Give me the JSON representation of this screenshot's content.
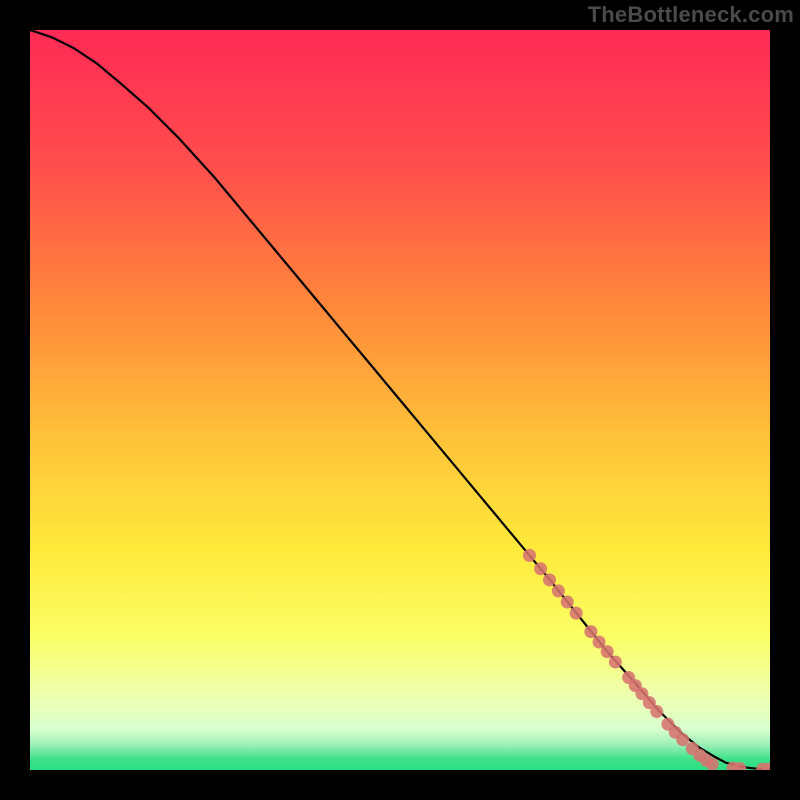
{
  "watermark": "TheBottleneck.com",
  "colors": {
    "curve": "#000000",
    "dot_fill": "#d6736e",
    "dot_stroke": "#8f3c38",
    "plot_bg_top": "#ff2a55",
    "plot_bg_mid1": "#ff8a3a",
    "plot_bg_mid2": "#ffd23a",
    "plot_bg_mid3": "#fff85a",
    "plot_bg_mid4": "#eaff8a",
    "plot_bg_green": "#3fe28a",
    "frame_bg": "#000000"
  },
  "chart_data": {
    "type": "line",
    "title": "",
    "xlabel": "",
    "ylabel": "",
    "xlim": [
      0,
      100
    ],
    "ylim": [
      0,
      100
    ],
    "series": [
      {
        "name": "curve",
        "x": [
          0,
          3,
          6,
          9,
          12,
          16,
          20,
          25,
          30,
          35,
          40,
          45,
          50,
          55,
          60,
          65,
          70,
          74,
          78,
          82,
          85,
          88,
          90.5,
          92.5,
          94,
          95.5,
          97,
          98.5,
          100
        ],
        "y": [
          100,
          99,
          97.5,
          95.5,
          93,
          89.5,
          85.5,
          80,
          74,
          68,
          62,
          56,
          50,
          44,
          38,
          32,
          26,
          21,
          16,
          11.5,
          8,
          5,
          3,
          1.8,
          1.0,
          0.6,
          0.3,
          0.15,
          0.1
        ]
      }
    ],
    "dots": [
      {
        "x": 67.5,
        "y": 29,
        "r": 6.5
      },
      {
        "x": 69.0,
        "y": 27.2,
        "r": 6.5
      },
      {
        "x": 70.2,
        "y": 25.7,
        "r": 6.5
      },
      {
        "x": 71.4,
        "y": 24.2,
        "r": 6.5
      },
      {
        "x": 72.6,
        "y": 22.7,
        "r": 6.5
      },
      {
        "x": 73.8,
        "y": 21.2,
        "r": 6.5
      },
      {
        "x": 75.8,
        "y": 18.7,
        "r": 6.5
      },
      {
        "x": 76.9,
        "y": 17.3,
        "r": 6.5
      },
      {
        "x": 78.0,
        "y": 16.0,
        "r": 6.5
      },
      {
        "x": 79.1,
        "y": 14.6,
        "r": 6.5
      },
      {
        "x": 80.9,
        "y": 12.5,
        "r": 6.5
      },
      {
        "x": 81.8,
        "y": 11.4,
        "r": 6.5
      },
      {
        "x": 82.7,
        "y": 10.3,
        "r": 6.5
      },
      {
        "x": 83.7,
        "y": 9.1,
        "r": 6.5
      },
      {
        "x": 84.7,
        "y": 7.9,
        "r": 6.5
      },
      {
        "x": 86.2,
        "y": 6.2,
        "r": 6.5
      },
      {
        "x": 87.2,
        "y": 5.1,
        "r": 6.5
      },
      {
        "x": 88.2,
        "y": 4.1,
        "r": 6.5
      },
      {
        "x": 89.5,
        "y": 2.9,
        "r": 6.5
      },
      {
        "x": 90.5,
        "y": 2.0,
        "r": 6.5
      },
      {
        "x": 91.4,
        "y": 1.3,
        "r": 6.5
      },
      {
        "x": 92.2,
        "y": 0.8,
        "r": 6.5
      },
      {
        "x": 95.0,
        "y": 0.25,
        "r": 6.5
      },
      {
        "x": 95.9,
        "y": 0.2,
        "r": 6.5
      },
      {
        "x": 99.0,
        "y": 0.1,
        "r": 6.5
      },
      {
        "x": 99.8,
        "y": 0.1,
        "r": 6.5
      }
    ],
    "gradient_stops": [
      {
        "offset": 0.0,
        "color": "#ff2a55"
      },
      {
        "offset": 0.18,
        "color": "#ff4d4d"
      },
      {
        "offset": 0.38,
        "color": "#ff8a3a"
      },
      {
        "offset": 0.55,
        "color": "#ffc23a"
      },
      {
        "offset": 0.7,
        "color": "#ffe93a"
      },
      {
        "offset": 0.82,
        "color": "#fbff66"
      },
      {
        "offset": 0.9,
        "color": "#eeffb0"
      },
      {
        "offset": 0.945,
        "color": "#d9ffcf"
      },
      {
        "offset": 0.965,
        "color": "#9ff0b8"
      },
      {
        "offset": 0.985,
        "color": "#3fe28a"
      },
      {
        "offset": 1.0,
        "color": "#2adf82"
      }
    ]
  }
}
